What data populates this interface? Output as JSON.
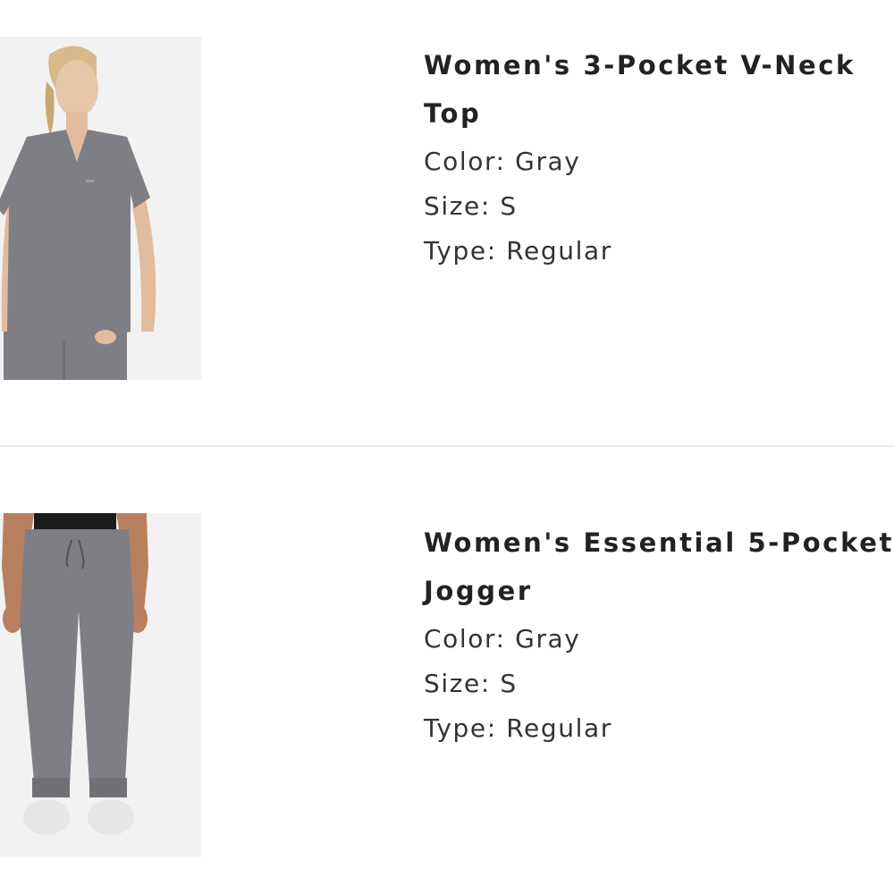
{
  "products": [
    {
      "title_line1": "Women's 3-Pocket V-Neck",
      "title_line2": "Top",
      "color": "Color: Gray",
      "size": "Size: S",
      "type": "Type: Regular",
      "image_icon": "v-neck-top-product-photo"
    },
    {
      "title_line1": "Women's Essential 5-Pocket",
      "title_line2": "Jogger",
      "color": "Color: Gray",
      "size": "Size: S",
      "type": "Type: Regular",
      "image_icon": "jogger-product-photo"
    }
  ],
  "colors": {
    "background": "#ffffff",
    "title": "#222222",
    "text": "#333333",
    "garment": "#7d7f84",
    "photo_bg": "#f2f2f2",
    "divider": "#ececec"
  }
}
